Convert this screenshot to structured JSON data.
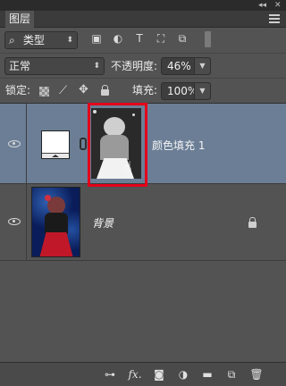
{
  "panel": {
    "collapse_glyph": "◂◂",
    "close_glyph": "✕",
    "tab_label": "图层",
    "menu_icon": "hamburger-menu-icon"
  },
  "filter_row": {
    "kind_label": "类型",
    "kind_prefix_icon": "search-icon",
    "filter_icons": [
      "image-filter-icon",
      "adjustment-filter-icon",
      "type-filter-icon",
      "shape-filter-icon",
      "smart-object-filter-icon"
    ],
    "filter_glyphs": [
      "▣",
      "◐",
      "T",
      "⛶",
      "⧉"
    ]
  },
  "blend_row": {
    "blend_mode": "正常",
    "opacity_label": "不透明度:",
    "opacity_value": "46%"
  },
  "lock_row": {
    "lock_label": "锁定:",
    "lock_icons": [
      "lock-transparent-pixels-icon",
      "lock-image-pixels-icon",
      "lock-position-icon",
      "lock-all-icon"
    ],
    "fill_label": "填充:",
    "fill_value": "100%"
  },
  "layers": [
    {
      "name": "颜色填充 1",
      "selected": true,
      "visible": true,
      "type": "fill-layer"
    },
    {
      "name": "背景",
      "selected": false,
      "visible": true,
      "locked": true,
      "type": "background"
    }
  ],
  "bottom_icons": [
    "link-layers-icon",
    "fx-effects-icon",
    "add-mask-icon",
    "adjustment-layer-icon",
    "new-group-icon",
    "new-layer-icon",
    "delete-icon"
  ],
  "bottom_labels": {
    "fx": "fx."
  },
  "colors": {
    "selected_layer": "#6b7e96",
    "highlight_box": "#e2001a",
    "panel_bg": "#535353"
  }
}
